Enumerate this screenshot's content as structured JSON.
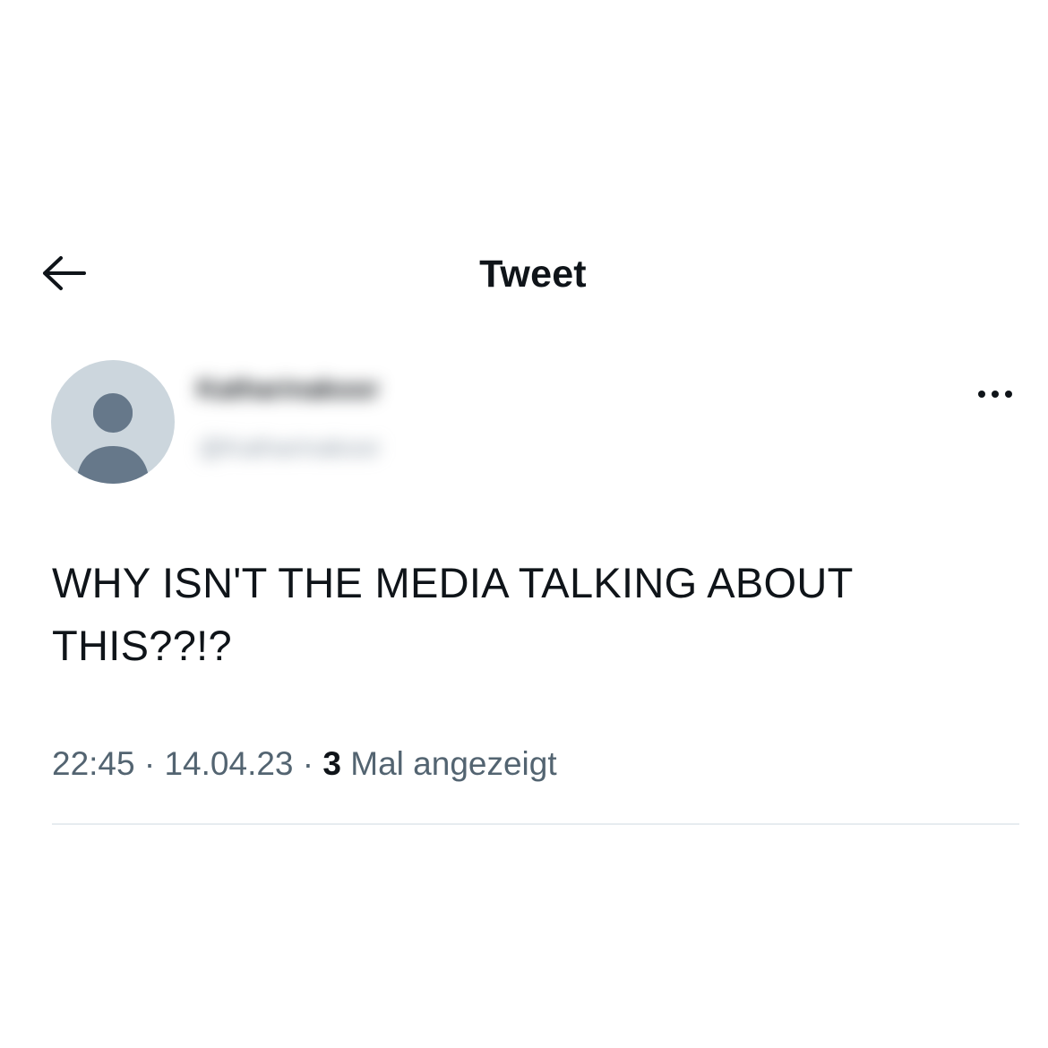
{
  "header": {
    "title": "Tweet"
  },
  "author": {
    "display_name": "Katharinakoor",
    "handle": "@Katharinakoor"
  },
  "tweet": {
    "text": "WHY ISN'T THE MEDIA TALKING ABOUT THIS??!?",
    "time": "22:45",
    "separator": " · ",
    "date": "14.04.23",
    "views_count": "3",
    "views_label": " Mal angezeigt"
  },
  "colors": {
    "text_primary": "#0f1419",
    "text_secondary": "#536471",
    "avatar_bg": "#ccd6dd",
    "avatar_figure": "#66788a",
    "divider": "#e6ecf0"
  },
  "icons": {
    "back": "arrow-left-icon",
    "more": "more-horizontal-icon",
    "avatar": "default-profile-icon"
  }
}
